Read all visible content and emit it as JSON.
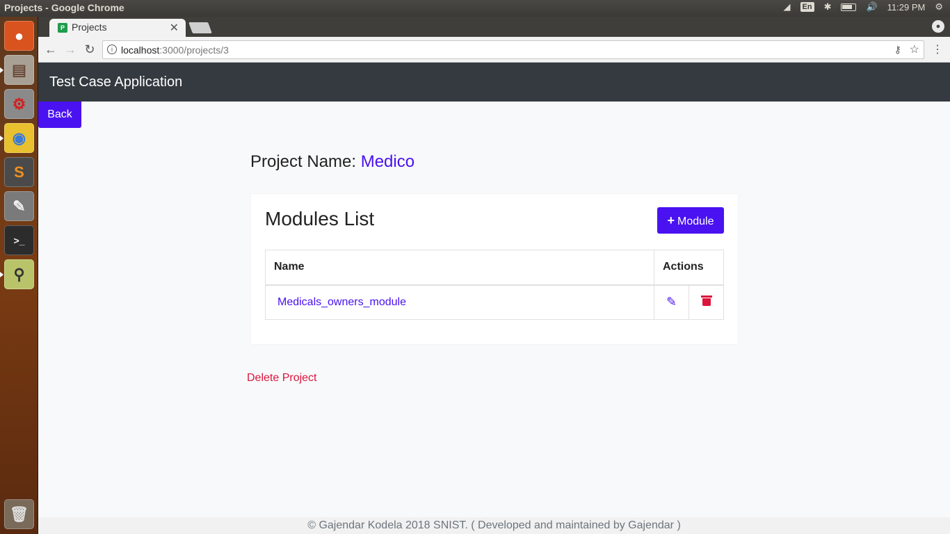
{
  "os": {
    "window_title": "Projects - Google Chrome",
    "keyboard_layout": "En",
    "clock": "11:29 PM",
    "launcher_items": [
      {
        "name": "ubuntu-dash",
        "icon": "ubuntu-logo-icon",
        "color": "#d9531e"
      },
      {
        "name": "files",
        "icon": "file-cabinet-icon",
        "color": "#a8a095"
      },
      {
        "name": "system-settings",
        "icon": "gear-wrench-icon",
        "color": "#8a8a8a"
      },
      {
        "name": "chrome",
        "icon": "chrome-icon",
        "color": "#e8c030"
      },
      {
        "name": "sublime-text",
        "icon": "sublime-s-icon",
        "color": "#4a4a4a"
      },
      {
        "name": "text-editor",
        "icon": "notepad-pencil-icon",
        "color": "#7a7a7a"
      },
      {
        "name": "terminal",
        "icon": "terminal-icon",
        "color": "#2c2c2c"
      },
      {
        "name": "log-viewer",
        "icon": "magnifier-doc-icon",
        "color": "#b9c46a"
      },
      {
        "name": "trash",
        "icon": "trash-can-icon",
        "color": "#7a6a5a"
      }
    ]
  },
  "browser": {
    "tab_title": "Projects",
    "url_host": "localhost",
    "url_rest": ":3000/projects/3"
  },
  "app": {
    "brand": "Test Case Application",
    "back_label": "Back",
    "project_label": "Project Name: ",
    "project_name": "Medico",
    "card_title": "Modules List",
    "add_module_label": "Module",
    "columns": [
      "Name",
      "Actions"
    ],
    "modules": [
      {
        "name": "Medicals_owners_module"
      }
    ],
    "delete_project_label": "Delete Project",
    "footer": "© Gajendar Kodela 2018 SNIST. ( Developed and maintained by Gajendar )"
  },
  "colors": {
    "primary": "#4a12f0",
    "danger": "#dc143c",
    "navbar": "#343a40"
  }
}
